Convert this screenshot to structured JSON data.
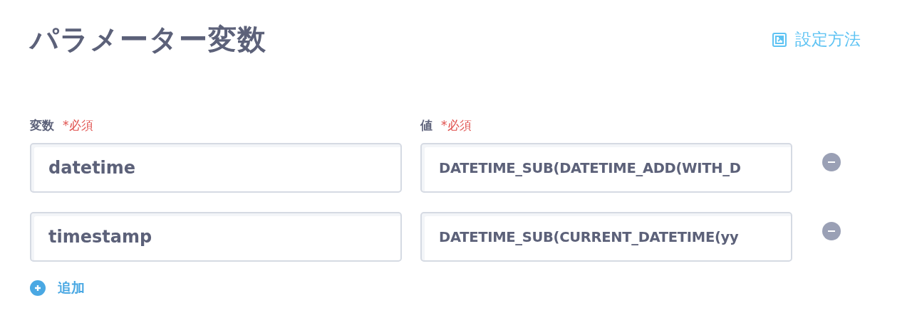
{
  "title": "パラメーター変数",
  "help_link": {
    "label": "設定方法"
  },
  "columns": [
    {
      "label": "変数",
      "required": "*必須"
    },
    {
      "label": "値",
      "required": "*必須"
    }
  ],
  "rows": [
    {
      "variable": "datetime",
      "value": "DATETIME_SUB(DATETIME_ADD(WITH_D"
    },
    {
      "variable": "timestamp",
      "value": "DATETIME_SUB(CURRENT_DATETIME(yy"
    }
  ],
  "add_button": {
    "label": "追加"
  }
}
